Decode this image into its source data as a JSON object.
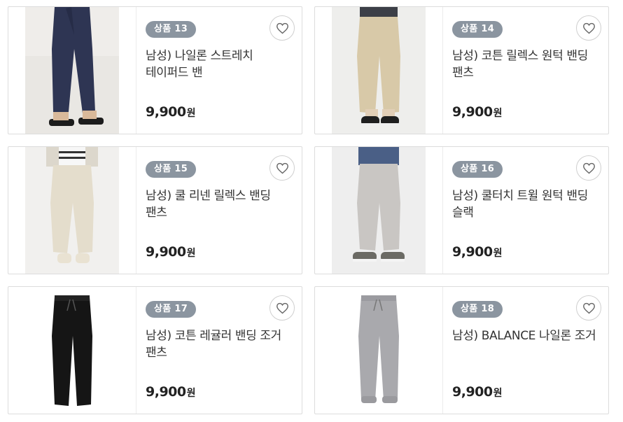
{
  "products": [
    {
      "badge": "상품 13",
      "title": "남성) 나일론 스트레치 테이퍼드 밴",
      "price": "9,900",
      "currency": "원",
      "image": "navy-tapered-pants-photo"
    },
    {
      "badge": "상품 14",
      "title": "남성) 코튼 릴렉스 원턱 밴딩 팬츠",
      "price": "9,900",
      "currency": "원",
      "image": "beige-cotton-pants-photo"
    },
    {
      "badge": "상품 15",
      "title": "남성) 쿨 리넨 릴렉스 밴딩 팬츠",
      "price": "9,900",
      "currency": "원",
      "image": "linen-pants-photo"
    },
    {
      "badge": "상품 16",
      "title": "남성) 쿨터치 트윌 원턱 밴딩 슬랙",
      "price": "9,900",
      "currency": "원",
      "image": "grey-twill-slacks-photo"
    },
    {
      "badge": "상품 17",
      "title": "남성) 코튼 레귤러 밴딩 조거 팬츠",
      "price": "9,900",
      "currency": "원",
      "image": "black-jogger-pants-photo"
    },
    {
      "badge": "상품 18",
      "title": "남성) BALANCE 나일론 조거",
      "price": "9,900",
      "currency": "원",
      "image": "grey-nylon-jogger-photo"
    }
  ],
  "icons": {
    "wishlist": "heart-outline-icon"
  },
  "colors": {
    "badge_bg": "#8b95a0",
    "border": "#dcdcdc"
  }
}
